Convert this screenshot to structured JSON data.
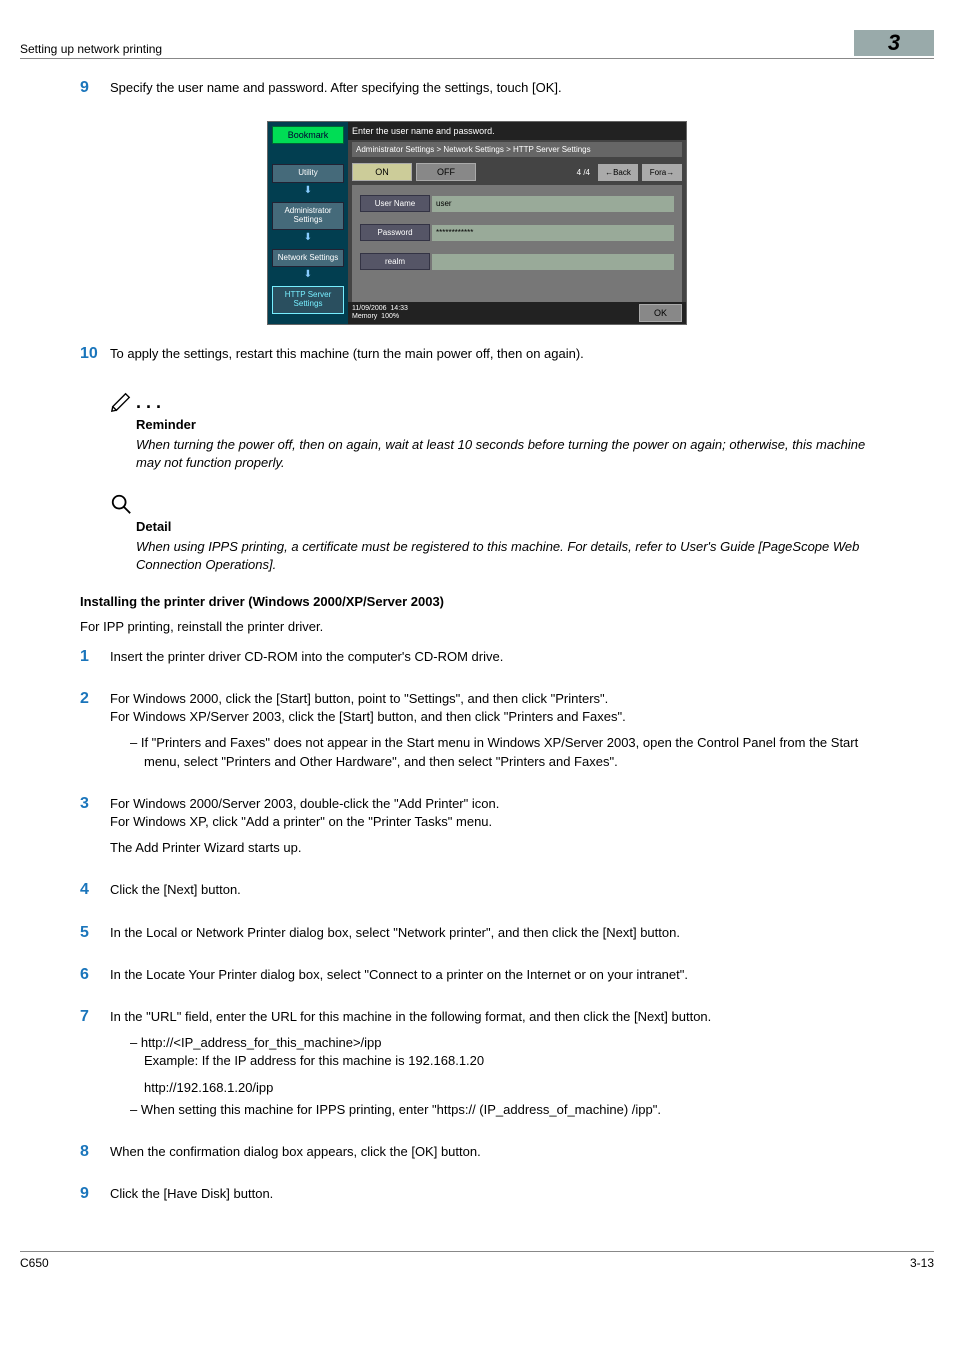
{
  "header": {
    "left": "Setting up network printing",
    "right": "3"
  },
  "steps_a": {
    "9": "Specify the user name and password. After specifying the settings, touch [OK].",
    "10": "To apply the settings, restart this machine (turn the main power off, then on again)."
  },
  "panel": {
    "top": "Enter the user name and password.",
    "crumb": "Administrator Settings > Network Settings > HTTP Server Settings",
    "tabs": {
      "on": "ON",
      "off": "OFF",
      "page": "4 /4",
      "back": "←Back",
      "forward": "Fora→"
    },
    "side": {
      "bookmark": "Bookmark",
      "items": [
        "Utility",
        "Administrator Settings",
        "Network Settings",
        "HTTP Server Settings"
      ]
    },
    "form": {
      "user_label": "User Name",
      "user_val": "user",
      "pass_label": "Password",
      "pass_val": "************",
      "realm_label": "realm",
      "realm_val": ""
    },
    "bottom": {
      "date": "11/09/2006",
      "time": "14:33",
      "mem": "Memory",
      "pct": "100%",
      "ok": "OK"
    }
  },
  "reminder": {
    "title": "Reminder",
    "text": "When turning the power off, then on again, wait at least 10 seconds before turning the power on again; otherwise, this machine may not function properly."
  },
  "detail": {
    "title": "Detail",
    "text": "When using IPPS printing, a certificate must be registered to this machine. For details, refer to User's Guide [PageScope Web Connection Operations]."
  },
  "section": {
    "title": "Installing the printer driver (Windows 2000/XP/Server 2003)",
    "intro": "For IPP printing, reinstall the printer driver."
  },
  "steps_b": {
    "1": {
      "p1": "Insert the printer driver CD-ROM into the computer's CD-ROM drive."
    },
    "2": {
      "p1": "For Windows 2000, click the [Start] button, point to \"Settings\", and then click \"Printers\".",
      "p2": "For Windows XP/Server 2003, click the [Start] button, and then click \"Printers and Faxes\".",
      "sub1": "–   If \"Printers and Faxes\" does not appear in the Start menu in Windows XP/Server 2003, open the Control Panel from the Start menu, select \"Printers and Other Hardware\", and then select \"Printers and Faxes\"."
    },
    "3": {
      "p1": "For Windows 2000/Server 2003, double-click the \"Add Printer\" icon.",
      "p2": "For Windows XP, click \"Add a printer\" on the \"Printer Tasks\" menu.",
      "p3": "The Add Printer Wizard starts up."
    },
    "4": {
      "p1": "Click the [Next] button."
    },
    "5": {
      "p1": "In the Local or Network Printer dialog box, select \"Network printer\", and then click the [Next] button."
    },
    "6": {
      "p1": "In the Locate Your Printer dialog box, select \"Connect to a printer on the Internet or on your intranet\"."
    },
    "7": {
      "p1": "In the \"URL\" field, enter the URL for this machine in the following format, and then click the [Next] button.",
      "sub1": "–   http://<IP_address_for_this_machine>/ipp",
      "sub1b": "Example: If the IP address for this machine is 192.168.1.20",
      "sub1c": "http://192.168.1.20/ipp",
      "sub2": "–   When setting this machine for IPPS printing, enter \"https:// (IP_address_of_machine) /ipp\"."
    },
    "8": {
      "p1": "When the confirmation dialog box appears, click the [OK] button."
    },
    "9b": {
      "p1": "Click the [Have Disk] button."
    }
  },
  "footer": {
    "left": "C650",
    "right": "3-13"
  }
}
